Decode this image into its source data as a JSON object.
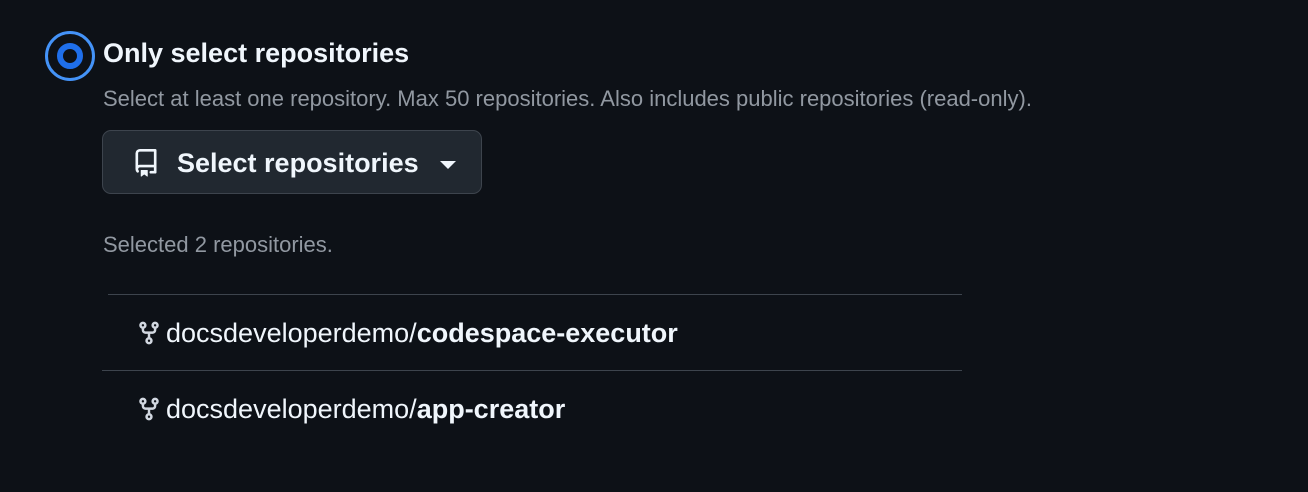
{
  "repository_access": {
    "option": {
      "label": "Only select repositories",
      "selected": true,
      "description": "Select at least one repository. Max 50 repositories. Also includes public repositories (read-only)."
    },
    "select_button": {
      "label": "Select repositories",
      "icon": "repo-icon",
      "dropdown_icon": "triangle-down-icon"
    },
    "selected_count_text": "Selected 2 repositories.",
    "repositories": [
      {
        "owner": "docsdeveloperdemo",
        "separator": "/",
        "name": "codespace-executor",
        "icon": "repo-forked-icon"
      },
      {
        "owner": "docsdeveloperdemo",
        "separator": "/",
        "name": "app-creator",
        "icon": "repo-forked-icon"
      }
    ]
  },
  "colors": {
    "background": "#0d1117",
    "accent": "#1f6feb",
    "text_primary": "#f0f6fc",
    "text_muted": "#9198a1",
    "border": "#3d444d",
    "button_bg": "#212830"
  }
}
